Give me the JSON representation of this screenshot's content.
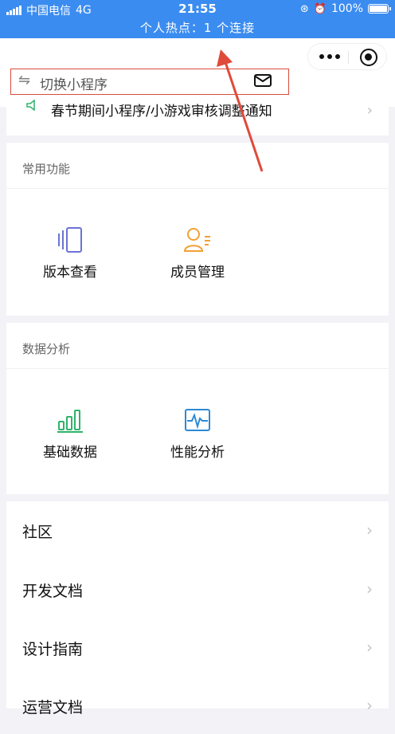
{
  "status_bar": {
    "carrier": "中国电信",
    "network": "4G",
    "time": "21:55",
    "battery": "100%",
    "hotspot": "个人热点：1 个连接"
  },
  "header": {
    "switch_label": "切换小程序",
    "icons": [
      "swap-icon",
      "mail-icon",
      "more-icon",
      "close-target-icon"
    ]
  },
  "notice": {
    "text": "春节期间小程序/小游戏审核调整通知"
  },
  "common": {
    "title": "常用功能",
    "items": [
      {
        "label": "版本查看",
        "icon": "versions-icon",
        "color": "#6b73d6"
      },
      {
        "label": "成员管理",
        "icon": "members-icon",
        "color": "#f2a035"
      }
    ]
  },
  "analysis": {
    "title": "数据分析",
    "items": [
      {
        "label": "基础数据",
        "icon": "bar-chart-icon",
        "color": "#2fb36a"
      },
      {
        "label": "性能分析",
        "icon": "performance-icon",
        "color": "#2b8ad6"
      }
    ]
  },
  "list": {
    "items": [
      {
        "label": "社区"
      },
      {
        "label": "开发文档"
      },
      {
        "label": "设计指南"
      },
      {
        "label": "运营文档"
      }
    ]
  },
  "colors": {
    "accent": "#3b8cf0",
    "highlight_box": "#d94b3e",
    "annotation_arrow": "#e04a3b"
  }
}
